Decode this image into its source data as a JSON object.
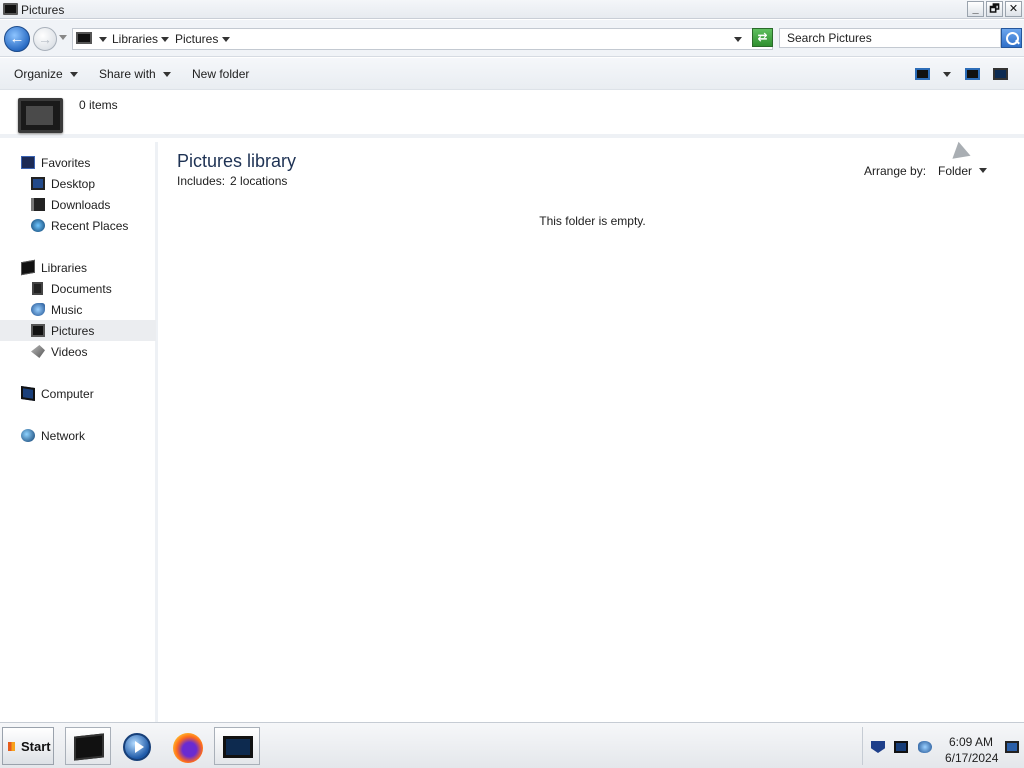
{
  "window": {
    "title": "Pictures",
    "controls": {
      "minimize": "_",
      "restore": "🗗",
      "close": "✕"
    }
  },
  "address_bar": {
    "back_label": "←",
    "forward_label": "→",
    "breadcrumbs": [
      "Libraries",
      "Pictures"
    ],
    "refresh_label": "⇄",
    "search_placeholder": "Search Pictures"
  },
  "command_bar": {
    "organize": "Organize",
    "share_with": "Share with",
    "new_folder": "New folder"
  },
  "details": {
    "item_count": "0 items"
  },
  "nav_pane": {
    "favorites": {
      "label": "Favorites",
      "items": [
        {
          "label": "Desktop",
          "icon": "desktop-icon"
        },
        {
          "label": "Downloads",
          "icon": "downloads-icon"
        },
        {
          "label": "Recent Places",
          "icon": "recent-places-icon"
        }
      ]
    },
    "libraries": {
      "label": "Libraries",
      "items": [
        {
          "label": "Documents",
          "icon": "documents-icon"
        },
        {
          "label": "Music",
          "icon": "music-icon"
        },
        {
          "label": "Pictures",
          "icon": "pictures-icon",
          "selected": true
        },
        {
          "label": "Videos",
          "icon": "videos-icon"
        }
      ]
    },
    "computer": {
      "label": "Computer"
    },
    "network": {
      "label": "Network"
    }
  },
  "content": {
    "library_title": "Pictures library",
    "includes_label": "Includes:",
    "includes_value": "2 locations",
    "arrange_label": "Arrange by:",
    "arrange_value": "Folder",
    "empty_message": "This folder is empty."
  },
  "taskbar": {
    "start_label": "Start",
    "pinned": [
      "explorer",
      "media-player",
      "firefox",
      "pictures-window"
    ],
    "clock_time": "6:09 AM",
    "clock_date": "6/17/2024"
  },
  "colors": {
    "library_title": "#1e3254",
    "selected_nav_bg": "#ebedf0",
    "accent_blue": "#2a6cc4"
  }
}
